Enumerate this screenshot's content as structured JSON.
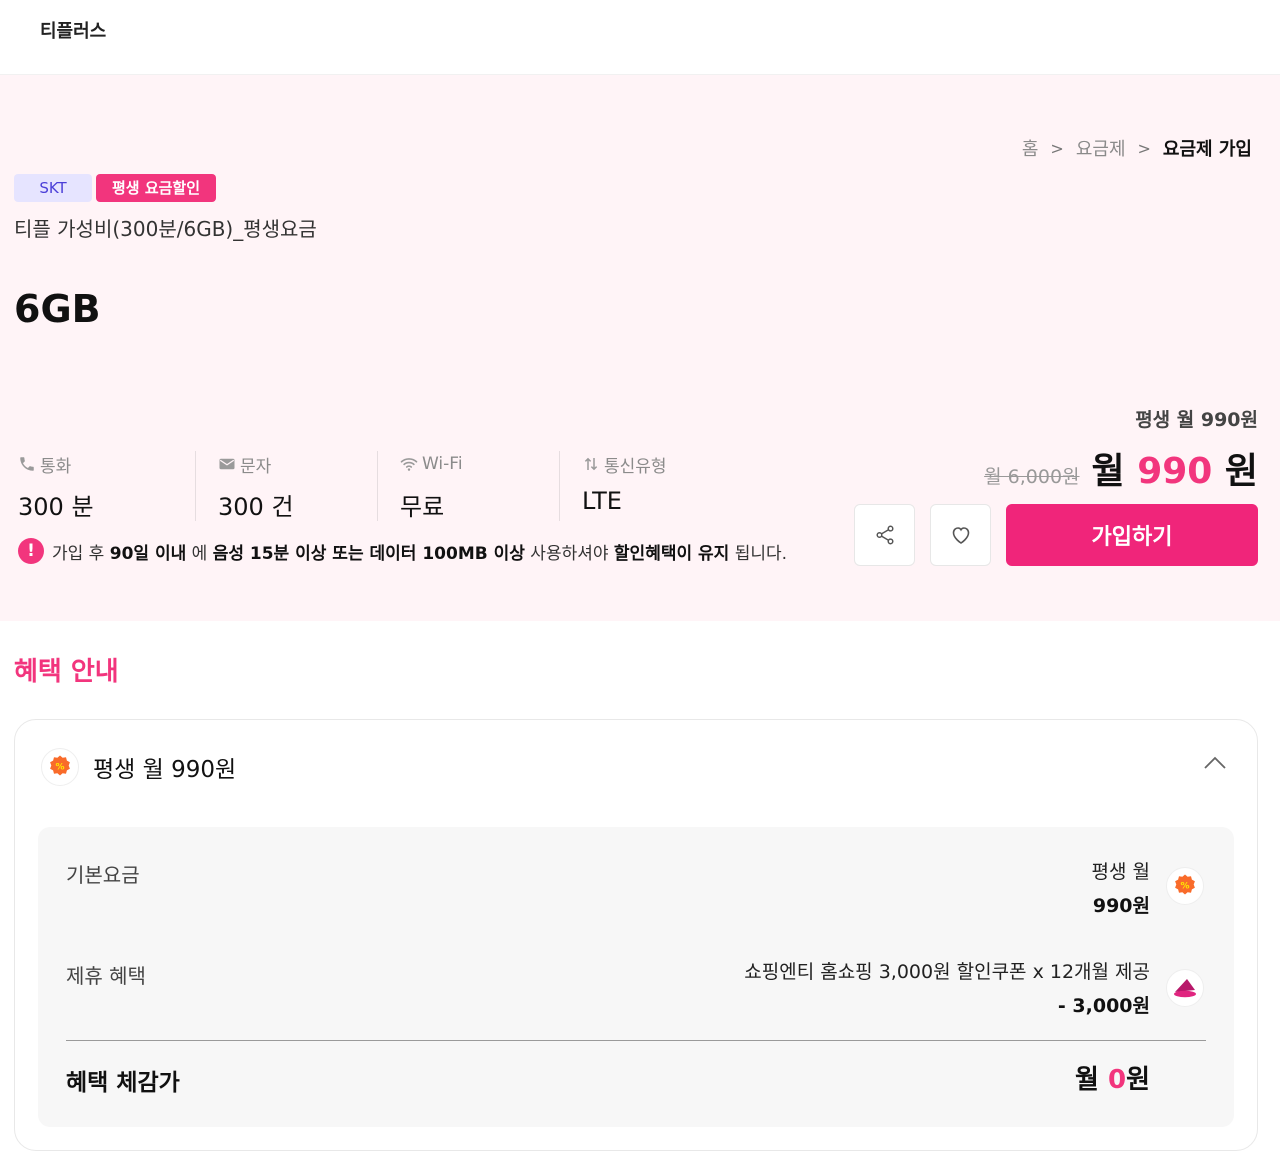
{
  "header": {
    "brand": "티플러스"
  },
  "breadcrumb": {
    "home": "홈",
    "plans": "요금제",
    "current": "요금제 가입"
  },
  "plan": {
    "carrier": "SKT",
    "promo_tag": "평생 요금할인",
    "name": "티플 가성비(300분/6GB)_평생요금",
    "data": "6GB"
  },
  "specs": [
    {
      "label": "통화",
      "value": "300 분",
      "icon": "phone-icon"
    },
    {
      "label": "문자",
      "value": "300 건",
      "icon": "mail-icon"
    },
    {
      "label": "Wi-Fi",
      "value": "무료",
      "icon": "wifi-icon"
    },
    {
      "label": "통신유형",
      "value": "LTE",
      "icon": "updown-arrows-icon"
    }
  ],
  "notice": {
    "p1": "가입 후 ",
    "b1": "90일 이내",
    "p2": " 에 ",
    "b2": "음성 15분 이상 또는 데이터 100MB 이상",
    "p3": " 사용하셔야 ",
    "b3": "할인혜택이 유지",
    "p4": " 됩니다."
  },
  "price": {
    "subtitle": "평생 월 990원",
    "original": "월 6,000원",
    "prefix": "월 ",
    "amount": "990",
    "suffix": " 원"
  },
  "actions": {
    "signup": "가입하기"
  },
  "benefits": {
    "section_title": "혜택 안내",
    "card_title": "평생 월 990원",
    "base_label": "기본요금",
    "base_line1": "평생 월",
    "base_line2": "990원",
    "partner_label": "제휴 혜택",
    "partner_line1": "쇼핑엔티 홈쇼핑 3,000원 할인쿠폰 x 12개월 제공",
    "partner_line2": "- 3,000원",
    "total_label": "혜택 체감가",
    "total_prefix": "월 ",
    "total_amount": "0",
    "total_suffix": "원"
  },
  "colors": {
    "accent": "#f2357d",
    "hero_bg": "#fff4f7",
    "carrier_tag": "#e6e4ff"
  }
}
